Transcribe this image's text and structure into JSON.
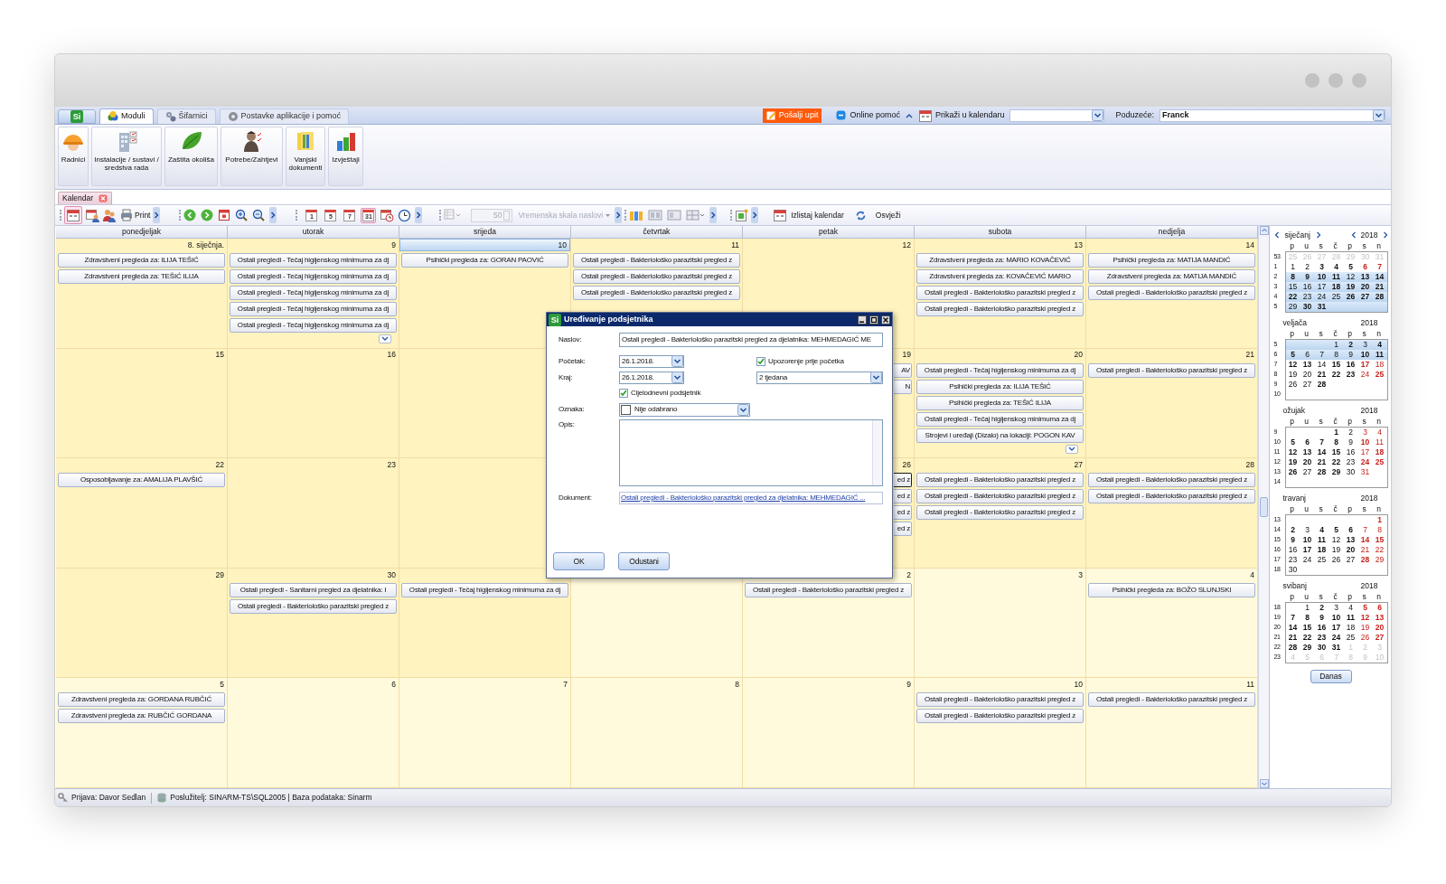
{
  "app_tabs": {
    "logo": "Si",
    "tabs": [
      {
        "label": "Moduli",
        "selected": true
      },
      {
        "label": "Šifarnici",
        "selected": false
      },
      {
        "label": "Postavke aplikacije i pomoć",
        "selected": false
      }
    ]
  },
  "top_actions": {
    "send_query": "Pošalji upit",
    "online_help": "Online pomoć",
    "show_in_calendar": "Prikaži u kalendaru",
    "company_label": "Poduzeće:",
    "company_value": "Franck"
  },
  "ribbon": [
    "Radnici",
    "Instalacije / sustavi / sredstva rada",
    "Zaštita okoliša",
    "Potrebe/Zahtjevi",
    "Vanjski dokumenti",
    "Izvještaji"
  ],
  "document_tab": "Kalendar",
  "toolbar": {
    "calendar_selected": true,
    "print": "Print",
    "views": [
      {
        "label": "1",
        "selected": false
      },
      {
        "label": "5",
        "selected": false
      },
      {
        "label": "7",
        "selected": false
      },
      {
        "label": "31",
        "selected": true
      }
    ],
    "scale": {
      "value": "50",
      "label": "Vremenska skala naslovi",
      "disabled": true
    },
    "list": "Izlistaj kalendar",
    "refresh": "Osvježi"
  },
  "calendar": {
    "weekdays": [
      "ponedjeljak",
      "utorak",
      "srijeda",
      "četvrtak",
      "petak",
      "subota",
      "nedjelja"
    ],
    "weeks": [
      {
        "cells": [
          {
            "day": "8. siječnja.",
            "today": false,
            "muted": false,
            "events": [
              {
                "text": "Zdravstveni pregleda za: ILIJA TEŠIĆ",
                "kind": "full",
                "selected": false
              },
              {
                "text": "Zdravstveni pregleda za: TEŠIĆ ILIJA",
                "kind": "full",
                "selected": false
              }
            ]
          },
          {
            "day": "9",
            "today": false,
            "muted": false,
            "more": true,
            "events": [
              {
                "text": "Ostali pregledi - Tečaj higijenskog minimuma za dj",
                "kind": "full",
                "selected": false
              },
              {
                "text": "Ostali pregledi - Tečaj higijenskog minimuma za dj",
                "kind": "full",
                "selected": false
              },
              {
                "text": "Ostali pregledi - Tečaj higijenskog minimuma za dj",
                "kind": "full",
                "selected": false
              },
              {
                "text": "Ostali pregledi - Tečaj higijenskog minimuma za dj",
                "kind": "full",
                "selected": false
              },
              {
                "text": "Ostali pregledi - Tečaj higijenskog minimuma za dj",
                "kind": "full",
                "selected": false
              }
            ]
          },
          {
            "day": "10",
            "today": true,
            "muted": false,
            "events": [
              {
                "text": "Psihički pregleda za: GORAN PAOVIĆ",
                "kind": "full",
                "selected": false
              }
            ]
          },
          {
            "day": "11",
            "today": false,
            "muted": false,
            "events": [
              {
                "text": "Ostali pregledi - Bakteriološko parazitski pregled z",
                "kind": "full",
                "selected": false
              },
              {
                "text": "Ostali pregledi - Bakteriološko parazitski pregled z",
                "kind": "full",
                "selected": false
              },
              {
                "text": "Ostali pregledi - Bakteriološko parazitski pregled z",
                "kind": "full",
                "selected": false
              }
            ]
          },
          {
            "day": "12",
            "today": false,
            "muted": false
          },
          {
            "day": "13",
            "today": false,
            "muted": false,
            "events": [
              {
                "text": "Zdravstveni pregleda za: MARIO KOVAČEVIĆ",
                "kind": "full",
                "selected": false
              },
              {
                "text": "Zdravstveni pregleda za: KOVAČEVIĆ MARIO",
                "kind": "full",
                "selected": false
              },
              {
                "text": "Ostali pregledi - Bakteriološko parazitski pregled z",
                "kind": "full",
                "selected": false
              },
              {
                "text": "Ostali pregledi - Bakteriološko parazitski pregled z",
                "kind": "full",
                "selected": false
              }
            ]
          },
          {
            "day": "14",
            "today": false,
            "muted": false,
            "events": [
              {
                "text": "Psihički pregleda za: MATIJA MANDIĆ",
                "kind": "full",
                "selected": false
              },
              {
                "text": "Zdravstveni pregleda za: MATIJA MANDIĆ",
                "kind": "full",
                "selected": false
              },
              {
                "text": "Ostali pregledi - Bakteriološko parazitski pregled z",
                "kind": "full",
                "selected": false
              }
            ]
          }
        ]
      },
      {
        "cells": [
          {
            "day": "15",
            "today": false,
            "muted": false
          },
          {
            "day": "16",
            "today": false,
            "muted": false
          },
          {},
          {},
          {
            "day": "19",
            "today": false,
            "muted": false,
            "events": [
              {
                "text": "AV",
                "kind": "partial",
                "selected": false
              },
              {
                "text": "N",
                "kind": "partial",
                "selected": false
              }
            ]
          },
          {
            "day": "20",
            "today": false,
            "muted": false,
            "more": true,
            "events": [
              {
                "text": "Ostali pregledi - Tečaj higijenskog minimuma za dj",
                "kind": "full",
                "selected": false
              },
              {
                "text": "Psihički pregleda za: ILIJA TEŠIĆ",
                "kind": "full",
                "selected": false
              },
              {
                "text": "Psihički pregleda za: TEŠIĆ ILIJA",
                "kind": "full",
                "selected": false
              },
              {
                "text": "Ostali pregledi - Tečaj higijenskog minimuma za dj",
                "kind": "full",
                "selected": false
              },
              {
                "text": "Strojevi i uređaji (Dizalo)  na lokaciji: POGON KAV",
                "kind": "full",
                "selected": false
              }
            ]
          },
          {
            "day": "21",
            "today": false,
            "muted": false,
            "events": [
              {
                "text": "Ostali pregledi - Bakteriološko parazitski pregled z",
                "kind": "full",
                "selected": false
              }
            ]
          }
        ]
      },
      {
        "cells": [
          {
            "day": "22",
            "today": false,
            "muted": false,
            "events": [
              {
                "text": "Osposobljavanje za: AMALIJA PLAVŠIĆ",
                "kind": "full",
                "selected": false
              }
            ]
          },
          {
            "day": "23",
            "today": false,
            "muted": false
          },
          {},
          {},
          {
            "day": "26",
            "today": false,
            "muted": false,
            "events": [
              {
                "text": "ed z",
                "kind": "partial",
                "selected": true
              },
              {
                "text": "ed z",
                "kind": "partial",
                "selected": false
              },
              {
                "text": "ed z",
                "kind": "partial",
                "selected": false
              },
              {
                "text": "ed z",
                "kind": "partial",
                "selected": false
              }
            ]
          },
          {
            "day": "27",
            "today": false,
            "muted": false,
            "events": [
              {
                "text": "Ostali pregledi - Bakteriološko parazitski pregled z",
                "kind": "full",
                "selected": false
              },
              {
                "text": "Ostali pregledi - Bakteriološko parazitski pregled z",
                "kind": "full",
                "selected": false
              },
              {
                "text": "Ostali pregledi - Bakteriološko parazitski pregled z",
                "kind": "full",
                "selected": false
              }
            ]
          },
          {
            "day": "28",
            "today": false,
            "muted": false,
            "events": [
              {
                "text": "Ostali pregledi - Bakteriološko parazitski pregled z",
                "kind": "full",
                "selected": false
              },
              {
                "text": "Ostali pregledi - Bakteriološko parazitski pregled z",
                "kind": "full",
                "selected": false
              }
            ]
          }
        ]
      },
      {
        "cells": [
          {
            "day": "29",
            "today": false,
            "muted": false
          },
          {
            "day": "30",
            "today": false,
            "muted": false,
            "events": [
              {
                "text": "Ostali pregledi - Sanitarni pregled za djelatnika: I",
                "kind": "full",
                "selected": false
              },
              {
                "text": "Ostali pregledi - Bakteriološko parazitski pregled z",
                "kind": "full",
                "selected": false
              }
            ]
          },
          {
            "today": false,
            "muted": false,
            "events": [
              {
                "text": "Ostali pregledi - Tečaj higijenskog minimuma za dj",
                "kind": "full",
                "selected": false
              }
            ]
          },
          {
            "today": false,
            "muted": true
          },
          {
            "day": "2",
            "today": false,
            "muted": true,
            "events": [
              {
                "text": "Ostali pregledi - Bakteriološko parazitski pregled z",
                "kind": "full",
                "selected": false
              }
            ]
          },
          {
            "day": "3",
            "today": false,
            "muted": true
          },
          {
            "day": "4",
            "today": false,
            "muted": true,
            "events": [
              {
                "text": "Psihički pregleda za: BOŽO SLUNJSKI",
                "kind": "full",
                "selected": false
              }
            ]
          }
        ]
      },
      {
        "cells": [
          {
            "day": "5",
            "today": false,
            "muted": true,
            "events": [
              {
                "text": "Zdravstveni pregleda za: GORDANA RUBČIĆ",
                "kind": "full",
                "selected": false
              },
              {
                "text": "Zdravstveni pregleda za: RUBČIĆ GORDANA",
                "kind": "full",
                "selected": false
              }
            ]
          },
          {
            "day": "6",
            "today": false,
            "muted": true
          },
          {
            "day": "7",
            "today": false,
            "muted": true
          },
          {
            "day": "8",
            "today": false,
            "muted": true
          },
          {
            "day": "9",
            "today": false,
            "muted": true
          },
          {
            "day": "10",
            "today": false,
            "muted": true,
            "events": [
              {
                "text": "Ostali pregledi - Bakteriološko parazitski pregled z",
                "kind": "full",
                "selected": false
              },
              {
                "text": "Ostali pregledi - Bakteriološko parazitski pregled z",
                "kind": "full",
                "selected": false
              }
            ]
          },
          {
            "day": "11",
            "today": false,
            "muted": true,
            "events": [
              {
                "text": "Ostali pregledi - Bakteriološko parazitski pregled z",
                "kind": "full",
                "selected": false
              }
            ]
          }
        ]
      }
    ]
  },
  "mini_calendars": [
    {
      "month": "siječanj",
      "year": "2018",
      "navigation": true,
      "weekdays": [
        "p",
        "u",
        "s",
        "č",
        "p",
        "s",
        "n"
      ],
      "weeks": [
        {
          "week": "53",
          "selected": false,
          "days": [
            {
              "d": "25",
              "bold": false,
              "muted": true
            },
            {
              "d": "26",
              "bold": false,
              "muted": true
            },
            {
              "d": "27",
              "bold": false,
              "muted": true
            },
            {
              "d": "28",
              "bold": false,
              "muted": true
            },
            {
              "d": "29",
              "bold": false,
              "muted": true
            },
            {
              "d": "30",
              "bold": false,
              "muted": true
            },
            {
              "d": "31",
              "bold": false,
              "muted": true
            }
          ]
        },
        {
          "week": "1",
          "selected": false,
          "days": [
            {
              "d": "1",
              "bold": false,
              "muted": false
            },
            {
              "d": "2",
              "bold": false,
              "muted": false
            },
            {
              "d": "3",
              "bold": true,
              "muted": false
            },
            {
              "d": "4",
              "bold": true,
              "muted": false
            },
            {
              "d": "5",
              "bold": true,
              "muted": false
            },
            {
              "d": "6",
              "bold": true,
              "muted": false
            },
            {
              "d": "7",
              "bold": true,
              "muted": false
            }
          ]
        },
        {
          "week": "2",
          "selected": true,
          "days": [
            {
              "d": "8",
              "bold": true,
              "muted": false
            },
            {
              "d": "9",
              "bold": true,
              "muted": false
            },
            {
              "d": "10",
              "bold": true,
              "muted": false
            },
            {
              "d": "11",
              "bold": true,
              "muted": false
            },
            {
              "d": "12",
              "bold": false,
              "muted": false
            },
            {
              "d": "13",
              "bold": true,
              "muted": false
            },
            {
              "d": "14",
              "bold": true,
              "muted": false
            }
          ]
        },
        {
          "week": "3",
          "selected": true,
          "days": [
            {
              "d": "15",
              "bold": false,
              "muted": false
            },
            {
              "d": "16",
              "bold": false,
              "muted": false
            },
            {
              "d": "17",
              "bold": false,
              "muted": false
            },
            {
              "d": "18",
              "bold": true,
              "muted": false
            },
            {
              "d": "19",
              "bold": true,
              "muted": false
            },
            {
              "d": "20",
              "bold": true,
              "muted": false
            },
            {
              "d": "21",
              "bold": true,
              "muted": false
            }
          ]
        },
        {
          "week": "4",
          "selected": true,
          "days": [
            {
              "d": "22",
              "bold": true,
              "muted": false
            },
            {
              "d": "23",
              "bold": false,
              "muted": false
            },
            {
              "d": "24",
              "bold": false,
              "muted": false
            },
            {
              "d": "25",
              "bold": false,
              "muted": false
            },
            {
              "d": "26",
              "bold": true,
              "muted": false
            },
            {
              "d": "27",
              "bold": true,
              "muted": false
            },
            {
              "d": "28",
              "bold": true,
              "muted": false
            }
          ]
        },
        {
          "week": "5",
          "selected": true,
          "days": [
            {
              "d": "29",
              "bold": false,
              "muted": false
            },
            {
              "d": "30",
              "bold": true,
              "muted": false
            },
            {
              "d": "31",
              "bold": true,
              "muted": false
            }
          ]
        }
      ]
    },
    {
      "month": "veljača",
      "year": "2018",
      "navigation": false,
      "weekdays": [
        "p",
        "u",
        "s",
        "č",
        "p",
        "s",
        "n"
      ],
      "weeks": [
        {
          "week": "5",
          "selected": true,
          "days": [
            {
              "d": "1",
              "bold": false,
              "muted": false
            },
            {
              "d": "2",
              "bold": true,
              "muted": false
            },
            {
              "d": "3",
              "bold": false,
              "muted": false
            },
            {
              "d": "4",
              "bold": true,
              "muted": false
            }
          ]
        },
        {
          "week": "6",
          "selected": true,
          "days": [
            {
              "d": "5",
              "bold": true,
              "muted": false
            },
            {
              "d": "6",
              "bold": false,
              "muted": false
            },
            {
              "d": "7",
              "bold": false,
              "muted": false
            },
            {
              "d": "8",
              "bold": false,
              "muted": false
            },
            {
              "d": "9",
              "bold": false,
              "muted": false
            },
            {
              "d": "10",
              "bold": true,
              "muted": false
            },
            {
              "d": "11",
              "bold": true,
              "muted": false
            }
          ]
        },
        {
          "week": "7",
          "selected": false,
          "days": [
            {
              "d": "12",
              "bold": true,
              "muted": false
            },
            {
              "d": "13",
              "bold": true,
              "muted": false
            },
            {
              "d": "14",
              "bold": false,
              "muted": false
            },
            {
              "d": "15",
              "bold": true,
              "muted": false
            },
            {
              "d": "16",
              "bold": true,
              "muted": false
            },
            {
              "d": "17",
              "bold": true,
              "muted": false
            },
            {
              "d": "18",
              "bold": false,
              "muted": false
            }
          ]
        },
        {
          "week": "8",
          "selected": false,
          "days": [
            {
              "d": "19",
              "bold": false,
              "muted": false
            },
            {
              "d": "20",
              "bold": false,
              "muted": false
            },
            {
              "d": "21",
              "bold": true,
              "muted": false
            },
            {
              "d": "22",
              "bold": true,
              "muted": false
            },
            {
              "d": "23",
              "bold": true,
              "muted": false
            },
            {
              "d": "24",
              "bold": false,
              "muted": false
            },
            {
              "d": "25",
              "bold": true,
              "muted": false
            }
          ]
        },
        {
          "week": "9",
          "selected": false,
          "days": [
            {
              "d": "26",
              "bold": false,
              "muted": false
            },
            {
              "d": "27",
              "bold": false,
              "muted": false
            },
            {
              "d": "28",
              "bold": true,
              "muted": false
            }
          ]
        },
        {
          "week": "10"
        }
      ]
    },
    {
      "month": "ožujak",
      "year": "2018",
      "navigation": false,
      "weekdays": [
        "p",
        "u",
        "s",
        "č",
        "p",
        "s",
        "n"
      ],
      "weeks": [
        {
          "week": "9",
          "selected": false,
          "days": [
            {
              "d": "1",
              "bold": true,
              "muted": false
            },
            {
              "d": "2",
              "bold": false,
              "muted": false
            },
            {
              "d": "3",
              "bold": false,
              "muted": false
            },
            {
              "d": "4",
              "bold": false,
              "muted": false
            }
          ]
        },
        {
          "week": "10",
          "selected": false,
          "days": [
            {
              "d": "5",
              "bold": true,
              "muted": false
            },
            {
              "d": "6",
              "bold": true,
              "muted": false
            },
            {
              "d": "7",
              "bold": true,
              "muted": false
            },
            {
              "d": "8",
              "bold": true,
              "muted": false
            },
            {
              "d": "9",
              "bold": false,
              "muted": false
            },
            {
              "d": "10",
              "bold": true,
              "muted": false
            },
            {
              "d": "11",
              "bold": false,
              "muted": false
            }
          ]
        },
        {
          "week": "11",
          "selected": false,
          "days": [
            {
              "d": "12",
              "bold": true,
              "muted": false
            },
            {
              "d": "13",
              "bold": true,
              "muted": false
            },
            {
              "d": "14",
              "bold": true,
              "muted": false
            },
            {
              "d": "15",
              "bold": true,
              "muted": false
            },
            {
              "d": "16",
              "bold": false,
              "muted": false
            },
            {
              "d": "17",
              "bold": false,
              "muted": false
            },
            {
              "d": "18",
              "bold": true,
              "muted": false
            }
          ]
        },
        {
          "week": "12",
          "selected": false,
          "days": [
            {
              "d": "19",
              "bold": true,
              "muted": false
            },
            {
              "d": "20",
              "bold": true,
              "muted": false
            },
            {
              "d": "21",
              "bold": true,
              "muted": false
            },
            {
              "d": "22",
              "bold": true,
              "muted": false
            },
            {
              "d": "23",
              "bold": false,
              "muted": false
            },
            {
              "d": "24",
              "bold": true,
              "muted": false
            },
            {
              "d": "25",
              "bold": true,
              "muted": false
            }
          ]
        },
        {
          "week": "13",
          "selected": false,
          "days": [
            {
              "d": "26",
              "bold": true,
              "muted": false
            },
            {
              "d": "27",
              "bold": false,
              "muted": false
            },
            {
              "d": "28",
              "bold": true,
              "muted": false
            },
            {
              "d": "29",
              "bold": true,
              "muted": false
            },
            {
              "d": "30",
              "bold": false,
              "muted": false
            },
            {
              "d": "31",
              "bold": false,
              "muted": false
            }
          ]
        },
        {
          "week": "14"
        }
      ]
    },
    {
      "month": "travanj",
      "year": "2018",
      "navigation": false,
      "weekdays": [
        "p",
        "u",
        "s",
        "č",
        "p",
        "s",
        "n"
      ],
      "weeks": [
        {
          "week": "13",
          "selected": false,
          "days": [
            {
              "d": "1",
              "bold": true,
              "muted": false
            }
          ]
        },
        {
          "week": "14",
          "selected": false,
          "days": [
            {
              "d": "2",
              "bold": true,
              "muted": false
            },
            {
              "d": "3",
              "bold": false,
              "muted": false
            },
            {
              "d": "4",
              "bold": true,
              "muted": false
            },
            {
              "d": "5",
              "bold": true,
              "muted": false
            },
            {
              "d": "6",
              "bold": true,
              "muted": false
            },
            {
              "d": "7",
              "bold": false,
              "muted": false
            },
            {
              "d": "8",
              "bold": false,
              "muted": false
            }
          ]
        },
        {
          "week": "15",
          "selected": false,
          "days": [
            {
              "d": "9",
              "bold": true,
              "muted": false
            },
            {
              "d": "10",
              "bold": true,
              "muted": false
            },
            {
              "d": "11",
              "bold": true,
              "muted": false
            },
            {
              "d": "12",
              "bold": false,
              "muted": false
            },
            {
              "d": "13",
              "bold": true,
              "muted": false
            },
            {
              "d": "14",
              "bold": true,
              "muted": false
            },
            {
              "d": "15",
              "bold": true,
              "muted": false
            }
          ]
        },
        {
          "week": "16",
          "selected": false,
          "days": [
            {
              "d": "16",
              "bold": false,
              "muted": false
            },
            {
              "d": "17",
              "bold": true,
              "muted": false
            },
            {
              "d": "18",
              "bold": true,
              "muted": false
            },
            {
              "d": "19",
              "bold": false,
              "muted": false
            },
            {
              "d": "20",
              "bold": true,
              "muted": false
            },
            {
              "d": "21",
              "bold": false,
              "muted": false
            },
            {
              "d": "22",
              "bold": false,
              "muted": false
            }
          ]
        },
        {
          "week": "17",
          "selected": false,
          "days": [
            {
              "d": "23",
              "bold": false,
              "muted": false
            },
            {
              "d": "24",
              "bold": false,
              "muted": false
            },
            {
              "d": "25",
              "bold": false,
              "muted": false
            },
            {
              "d": "26",
              "bold": false,
              "muted": false
            },
            {
              "d": "27",
              "bold": false,
              "muted": false
            },
            {
              "d": "28",
              "bold": true,
              "muted": false
            },
            {
              "d": "29",
              "bold": false,
              "muted": false
            }
          ]
        },
        {
          "week": "18",
          "selected": false,
          "days": [
            {
              "d": "30",
              "bold": false,
              "muted": false
            }
          ]
        }
      ]
    },
    {
      "month": "svibanj",
      "year": "2018",
      "navigation": false,
      "weekdays": [
        "p",
        "u",
        "s",
        "č",
        "p",
        "s",
        "n"
      ],
      "weeks": [
        {
          "week": "18",
          "selected": false,
          "days": [
            {
              "d": "1",
              "bold": false,
              "muted": false
            },
            {
              "d": "2",
              "bold": true,
              "muted": false
            },
            {
              "d": "3",
              "bold": false,
              "muted": false
            },
            {
              "d": "4",
              "bold": false,
              "muted": false
            },
            {
              "d": "5",
              "bold": true,
              "muted": false
            },
            {
              "d": "6",
              "bold": true,
              "muted": false
            }
          ]
        },
        {
          "week": "19",
          "selected": false,
          "days": [
            {
              "d": "7",
              "bold": true,
              "muted": false
            },
            {
              "d": "8",
              "bold": true,
              "muted": false
            },
            {
              "d": "9",
              "bold": true,
              "muted": false
            },
            {
              "d": "10",
              "bold": true,
              "muted": false
            },
            {
              "d": "11",
              "bold": true,
              "muted": false
            },
            {
              "d": "12",
              "bold": true,
              "muted": false
            },
            {
              "d": "13",
              "bold": true,
              "muted": false
            }
          ]
        },
        {
          "week": "20",
          "selected": false,
          "days": [
            {
              "d": "14",
              "bold": true,
              "muted": false
            },
            {
              "d": "15",
              "bold": true,
              "muted": false
            },
            {
              "d": "16",
              "bold": true,
              "muted": false
            },
            {
              "d": "17",
              "bold": true,
              "muted": false
            },
            {
              "d": "18",
              "bold": false,
              "muted": false
            },
            {
              "d": "19",
              "bold": false,
              "muted": false
            },
            {
              "d": "20",
              "bold": true,
              "muted": false
            }
          ]
        },
        {
          "week": "21",
          "selected": false,
          "days": [
            {
              "d": "21",
              "bold": true,
              "muted": false
            },
            {
              "d": "22",
              "bold": true,
              "muted": false
            },
            {
              "d": "23",
              "bold": true,
              "muted": false
            },
            {
              "d": "24",
              "bold": true,
              "muted": false
            },
            {
              "d": "25",
              "bold": false,
              "muted": false
            },
            {
              "d": "26",
              "bold": false,
              "muted": false
            },
            {
              "d": "27",
              "bold": true,
              "muted": false
            }
          ]
        },
        {
          "week": "22",
          "selected": false,
          "days": [
            {
              "d": "28",
              "bold": true,
              "muted": false
            },
            {
              "d": "29",
              "bold": true,
              "muted": false
            },
            {
              "d": "30",
              "bold": true,
              "muted": false
            },
            {
              "d": "31",
              "bold": true,
              "muted": false
            },
            {
              "d": "1",
              "bold": false,
              "muted": true
            },
            {
              "d": "2",
              "bold": false,
              "muted": true
            },
            {
              "d": "3",
              "bold": false,
              "muted": true
            }
          ]
        },
        {
          "week": "23",
          "selected": false,
          "days": [
            {
              "d": "4",
              "bold": false,
              "muted": true
            },
            {
              "d": "5",
              "bold": false,
              "muted": true
            },
            {
              "d": "6",
              "bold": false,
              "muted": true
            },
            {
              "d": "7",
              "bold": false,
              "muted": true
            },
            {
              "d": "8",
              "bold": false,
              "muted": true
            },
            {
              "d": "9",
              "bold": false,
              "muted": true
            },
            {
              "d": "10",
              "bold": false,
              "muted": true
            }
          ]
        }
      ]
    }
  ],
  "today_button": "Danas",
  "dialog": {
    "logo": "Si",
    "title": "Uređivanje podsjetnika",
    "title_label": "Naslov:",
    "title_value": "Ostali pregledi - Bakteriološko parazitski pregled za djelatnika: MEHMEDAGIĆ ME",
    "start_label": "Početak:",
    "start_value": "26.1.2018.",
    "end_label": "Kraj:",
    "end_value": "26.1.2018.",
    "reminder": {
      "label": "Upozorenje prije početka",
      "checked": true
    },
    "reminder_value": "2 tjedana",
    "all_day": {
      "label": "Cijelodnevni podsjetnik",
      "checked": true
    },
    "tag_label": "Oznaka:",
    "tag_value": "Nije odabrano",
    "description_label": "Opis:",
    "document_label": "Dokument:",
    "document_link": "Ostali pregledi - Bakteriološko parazitski pregled za djelatnika: MEHMEDAGIĆ ...",
    "buttons": [
      "OK",
      "Odustani"
    ]
  },
  "status_bar": {
    "login": "Prijava: Davor Sedlan",
    "server": "Poslužitelj: SINARM-TS\\SQL2005 | Baza podataka: Sinarm"
  }
}
